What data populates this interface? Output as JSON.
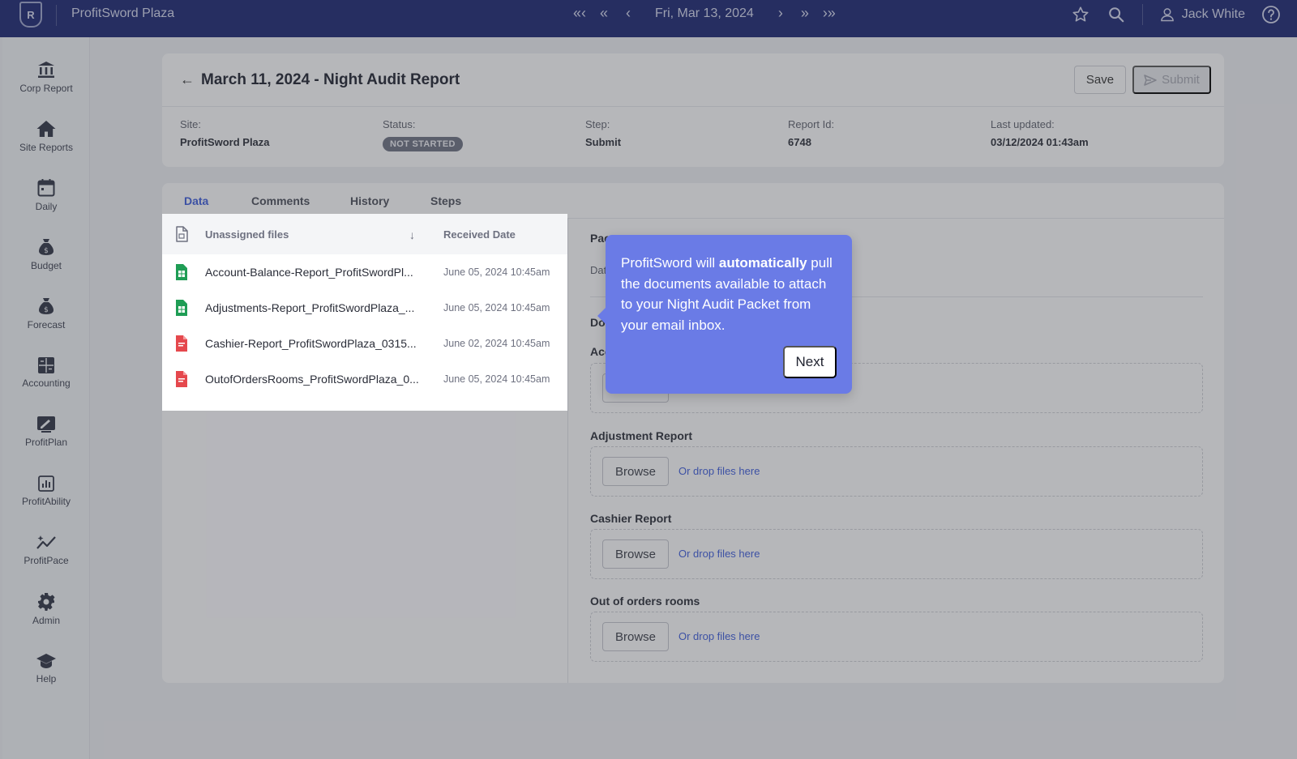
{
  "topbar": {
    "logo_text": "R",
    "app_title": "ProfitSword Plaza",
    "date": "Fri, Mar 13, 2024",
    "user_name": "Jack White"
  },
  "sidebar": {
    "items": [
      {
        "label": "Corp Report",
        "icon": "bank-icon"
      },
      {
        "label": "Site Reports",
        "icon": "home-icon"
      },
      {
        "label": "Daily",
        "icon": "calendar-icon"
      },
      {
        "label": "Budget",
        "icon": "money-bag-icon"
      },
      {
        "label": "Forecast",
        "icon": "money-bag-icon"
      },
      {
        "label": "Accounting",
        "icon": "calculator-icon"
      },
      {
        "label": "ProfitPlan",
        "icon": "chart-edit-icon"
      },
      {
        "label": "ProfitAbility",
        "icon": "bar-chart-icon"
      },
      {
        "label": "ProfitPace",
        "icon": "trend-icon"
      },
      {
        "label": "Admin",
        "icon": "gear-icon"
      },
      {
        "label": "Help",
        "icon": "graduation-cap-icon"
      }
    ]
  },
  "report": {
    "title": "March 11, 2024 - Night Audit Report",
    "save_label": "Save",
    "submit_label": "Submit",
    "meta": {
      "site_label": "Site:",
      "site_value": "ProfitSword Plaza",
      "status_label": "Status:",
      "status_value": "NOT STARTED",
      "step_label": "Step:",
      "step_value": "Submit",
      "report_id_label": "Report Id:",
      "report_id_value": "6748",
      "last_updated_label": "Last updated:",
      "last_updated_value": "03/12/2024 01:43am"
    }
  },
  "tabs": [
    "Data",
    "Comments",
    "History",
    "Steps"
  ],
  "files": {
    "col_name": "Unassigned files",
    "col_date": "Received Date",
    "rows": [
      {
        "name": "Account-Balance-Report_ProfitSwordPl...",
        "date": "June 05, 2024 10:45am",
        "type": "sheet"
      },
      {
        "name": "Adjustments-Report_ProfitSwordPlaza_...",
        "date": "June 05, 2024 10:45am",
        "type": "sheet"
      },
      {
        "name": "Cashier-Report_ProfitSwordPlaza_0315...",
        "date": "June 02, 2024 10:45am",
        "type": "pdf"
      },
      {
        "name": "OutofOrdersRooms_ProfitSwordPlaza_0...",
        "date": "June 05, 2024 10:45am",
        "type": "pdf"
      }
    ]
  },
  "packet": {
    "cut_title": "Pac",
    "cut_date": "Dat",
    "cut_doc": "Do",
    "cut_acc": "Acc",
    "sections": [
      {
        "title": "Adjustment Report",
        "browse": "Browse",
        "drop": "Or drop files here"
      },
      {
        "title": "Cashier Report",
        "browse": "Browse",
        "drop": "Or drop files here"
      },
      {
        "title": "Out of orders rooms",
        "browse": "Browse",
        "drop": "Or drop files here"
      }
    ]
  },
  "tooltip": {
    "text_before": "ProfitSword will ",
    "text_bold": "automatically",
    "text_after": " pull the documents available to attach to your Night Audit Packet from your email inbox.",
    "next_label": "Next"
  },
  "colors": {
    "topbar": "#1b2570",
    "accent": "#3d5bd8",
    "tooltip": "#6a7be6"
  }
}
